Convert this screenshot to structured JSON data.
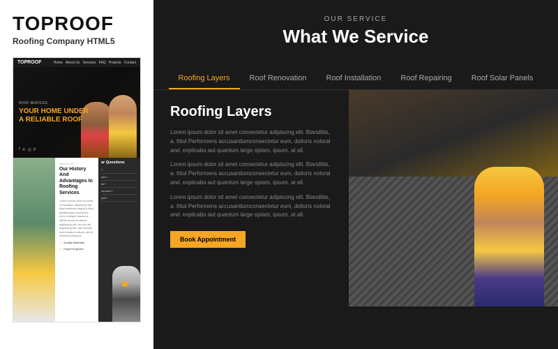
{
  "left_panel": {
    "brand_title": "TOPROOF",
    "brand_subtitle": "Roofing Company HTML5",
    "mini_site": {
      "nav": {
        "logo": "TOPROOF",
        "links": [
          "Home",
          "About Us",
          "Services",
          "FAQ",
          "Projects",
          "Contact"
        ]
      },
      "hero": {
        "tag": "ROOF SERVICES",
        "headline_line1": "YOUR HOME UNDER",
        "headline_line2": "A RELIABLE ROOF"
      },
      "about": {
        "tag": "ABOUT US",
        "title": "Our History And Advantages In Roofing Services",
        "text": "Lorem ipsum dolor sit amet consectetur adipiscing elit. Mabi particuli magnit a illum quialibusdem possimus orem undique maximus officiis quam sit aliqua adipiscing elit, sed do nisi adipiscing elit, nisi incidunt enim ullamco laboris nisi et deserunt tempora.",
        "features": [
          "Quality Materials",
          "Expert Engineer"
        ]
      },
      "faq": {
        "title": "ar Questions",
        "items": [
          "?",
          "ake?",
          "fer?",
          "surance?",
          "pair?"
        ]
      }
    }
  },
  "right_panel": {
    "our_service_label": "OUR SERVICE",
    "main_title": "What We Service",
    "tabs": [
      {
        "label": "Roofing Layers",
        "active": true
      },
      {
        "label": "Roof Renovation",
        "active": false
      },
      {
        "label": "Roof Installation",
        "active": false
      },
      {
        "label": "Roof Repairing",
        "active": false
      },
      {
        "label": "Roof Solar Panels",
        "active": false
      }
    ],
    "active_service": {
      "heading": "Roofing Layers",
      "paragraphs": [
        "Lorem ipsum dolor sit amet consectetur adipiscing elit. Blanditiis, a. Ititul Performens accusantiumconsectetur eum, dolloris noloral and. explicabo aut quantum large optam, ipsum. at all.",
        "Lorem ipsum dolor sit amet consectetur adipiscing elit. Blanditiis, a. Ititul Performens accusantiumconsectetur eum, dolloris noloral and. explicabo aut quantum large optam, ipsum. at all.",
        "Lorem ipsum dolor sit amet consectetur adipiscing elit. Blanditiis, a. Ititul Performens accusantiumconsectetur eum, dolloris noloral and. explicabo aut quantum large optam, ipsum. at all."
      ],
      "book_btn_label": "Book Appointment"
    }
  },
  "colors": {
    "accent": "#f5a623",
    "bg_dark": "#1a1a1a",
    "text_light": "#ffffff",
    "text_muted": "#888888",
    "active_tab": "#f5a623"
  }
}
